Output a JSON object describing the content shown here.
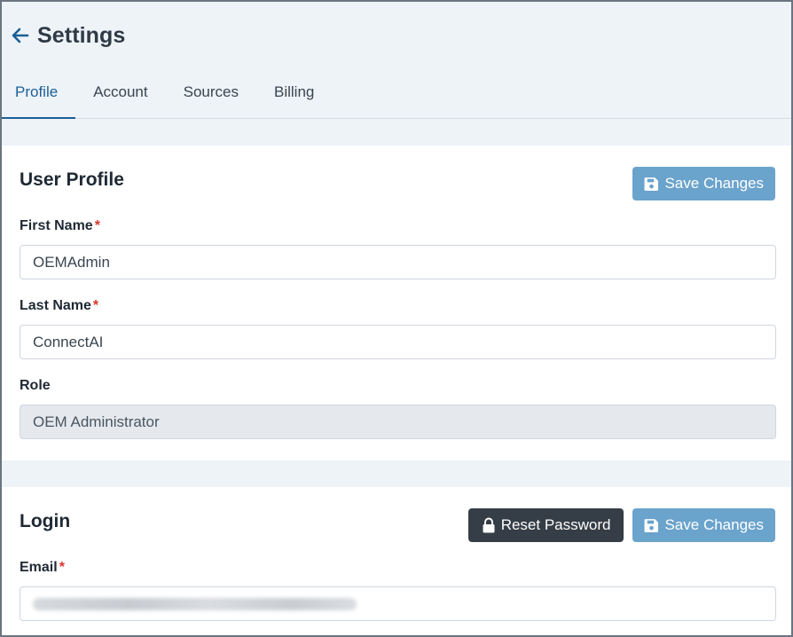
{
  "header": {
    "title": "Settings"
  },
  "tabs": [
    {
      "label": "Profile",
      "active": true
    },
    {
      "label": "Account",
      "active": false
    },
    {
      "label": "Sources",
      "active": false
    },
    {
      "label": "Billing",
      "active": false
    }
  ],
  "profile": {
    "title": "User Profile",
    "save_label": "Save Changes",
    "first_name_label": "First Name",
    "first_name_value": "OEMAdmin",
    "last_name_label": "Last Name",
    "last_name_value": "ConnectAI",
    "role_label": "Role",
    "role_value": "OEM Administrator",
    "required_mark": "*"
  },
  "login": {
    "title": "Login",
    "reset_label": "Reset Password",
    "save_label": "Save Changes",
    "email_label": "Email",
    "required_mark": "*"
  },
  "colors": {
    "accent": "#1c5f96",
    "save_button": "#6aa3cc",
    "dark_button": "#353d46",
    "required": "#d9342b"
  },
  "icons": {
    "back": "arrow-left-icon",
    "save": "floppy-disk-icon",
    "reset": "lock-icon"
  }
}
